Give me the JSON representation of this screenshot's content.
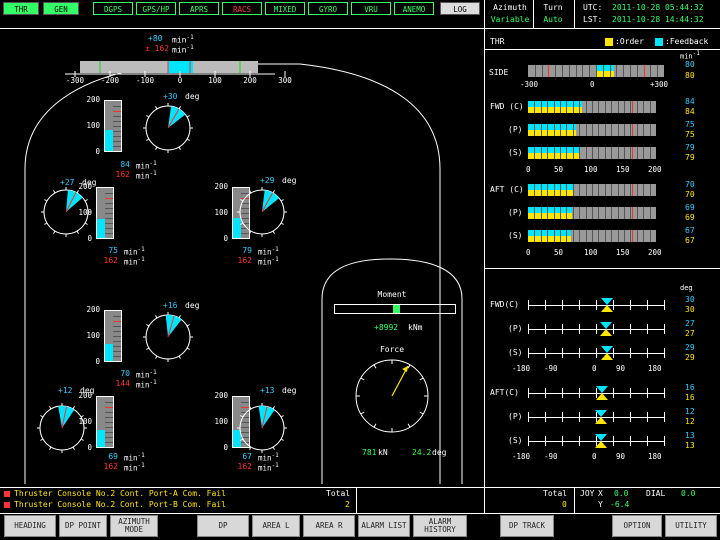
{
  "tabs": [
    {
      "label": "THR",
      "state": "on"
    },
    {
      "label": "GEN",
      "state": "on"
    },
    {
      "label": "DGPS",
      "state": "off"
    },
    {
      "label": "GPS/HP",
      "state": "off"
    },
    {
      "label": "APRS",
      "state": "off"
    },
    {
      "label": "RACS",
      "state": "red"
    },
    {
      "label": "MIXED",
      "state": "off"
    },
    {
      "label": "GYRO",
      "state": "off"
    },
    {
      "label": "VRU",
      "state": "off"
    },
    {
      "label": "ANEMO",
      "state": "off"
    },
    {
      "label": "LOG",
      "state": "log"
    }
  ],
  "mode": {
    "azimuth_label": "Azimuth",
    "azimuth_value": "Variable",
    "turn_label": "Turn",
    "turn_value": "Auto"
  },
  "clock": {
    "utc_label": "UTC:",
    "utc": "2011-10-28 05:44:32",
    "lst_label": "LST:",
    "lst": "2011-10-28 14:44:32"
  },
  "thr_panel": {
    "title": "THR",
    "order_label": ":Order",
    "feedback_label": ":Feedback",
    "unit": "min",
    "side": {
      "label": "SIDE",
      "ticks": [
        "-300",
        "0",
        "+300"
      ],
      "feedback": "80",
      "order": "80"
    },
    "fwd_ticks": [
      "0",
      "50",
      "100",
      "150",
      "200"
    ],
    "fwd": [
      {
        "label": "FWD (C)",
        "feedback": "84",
        "order": "84"
      },
      {
        "label": "(P)",
        "feedback": "75",
        "order": "75"
      },
      {
        "label": "(S)",
        "feedback": "79",
        "order": "79"
      }
    ],
    "aft": [
      {
        "label": "AFT (C)",
        "feedback": "70",
        "order": "70"
      },
      {
        "label": "(P)",
        "feedback": "69",
        "order": "69"
      },
      {
        "label": "(S)",
        "feedback": "67",
        "order": "67"
      }
    ]
  },
  "deg_panel": {
    "unit": "deg",
    "ticks": [
      "-180",
      "-90",
      "0",
      "90",
      "180"
    ],
    "fwd": [
      {
        "label": "FWD(C)",
        "feedback": "30",
        "order": "30"
      },
      {
        "label": "(P)",
        "feedback": "27",
        "order": "27"
      },
      {
        "label": "(S)",
        "feedback": "29",
        "order": "29"
      }
    ],
    "aft": [
      {
        "label": "AFT(C)",
        "feedback": "16",
        "order": "16"
      },
      {
        "label": "(P)",
        "feedback": "12",
        "order": "12"
      },
      {
        "label": "(S)",
        "feedback": "13",
        "order": "13"
      }
    ]
  },
  "ship": {
    "side_thruster": {
      "feedback": "+80",
      "order": "± 162",
      "unit": "min",
      "ticks": [
        "-300",
        "-200",
        "-100",
        "0",
        "100",
        "200",
        "300"
      ]
    },
    "thrusters": [
      {
        "name": "fwd-c",
        "deg": "+30",
        "rpm": "84",
        "rpm_order": "162",
        "scale": [
          "200",
          "100",
          "0"
        ]
      },
      {
        "name": "fwd-p",
        "deg": "+27",
        "rpm": "75",
        "rpm_order": "162",
        "scale": [
          "200",
          "100",
          "0"
        ]
      },
      {
        "name": "fwd-s",
        "deg": "+29",
        "rpm": "79",
        "rpm_order": "162",
        "scale": [
          "200",
          "100",
          "0"
        ]
      },
      {
        "name": "aft-c",
        "deg": "+16",
        "rpm": "70",
        "rpm_order": "144",
        "scale": [
          "200",
          "100",
          "0"
        ]
      },
      {
        "name": "aft-p",
        "deg": "+12",
        "rpm": "69",
        "rpm_order": "162",
        "scale": [
          "200",
          "100",
          "0"
        ]
      },
      {
        "name": "aft-s",
        "deg": "+13",
        "rpm": "67",
        "rpm_order": "162",
        "scale": [
          "200",
          "100",
          "0"
        ]
      }
    ],
    "unit_deg": "deg",
    "unit_rpm": "min"
  },
  "moment": {
    "title": "Moment",
    "value": "+8992",
    "unit": "kNm"
  },
  "force": {
    "title": "Force",
    "value": "781",
    "unit": "kN",
    "deg": "24.2",
    "deg_unit": "deg"
  },
  "alarms": {
    "items": [
      "Thruster Console No.2 Cont. Port-A Com. Fail",
      "Thruster Console No.2 Cont. Port-B Com. Fail"
    ],
    "total_label": "Total",
    "total": "2",
    "total2_label": "Total",
    "total2": "0"
  },
  "joy": {
    "label": "JOY",
    "x_label": "X",
    "x": "0.0",
    "y_label": "Y",
    "y": "-6.4",
    "dial_label": "DIAL",
    "dial": "0.0"
  },
  "buttons": [
    "HEADING",
    "DP POINT",
    "AZIMUTH MODE",
    "DP",
    "AREA L",
    "AREA R",
    "ALARM LIST",
    "ALARM HISTORY",
    "DP TRACK",
    "OPTION",
    "UTILITY"
  ]
}
